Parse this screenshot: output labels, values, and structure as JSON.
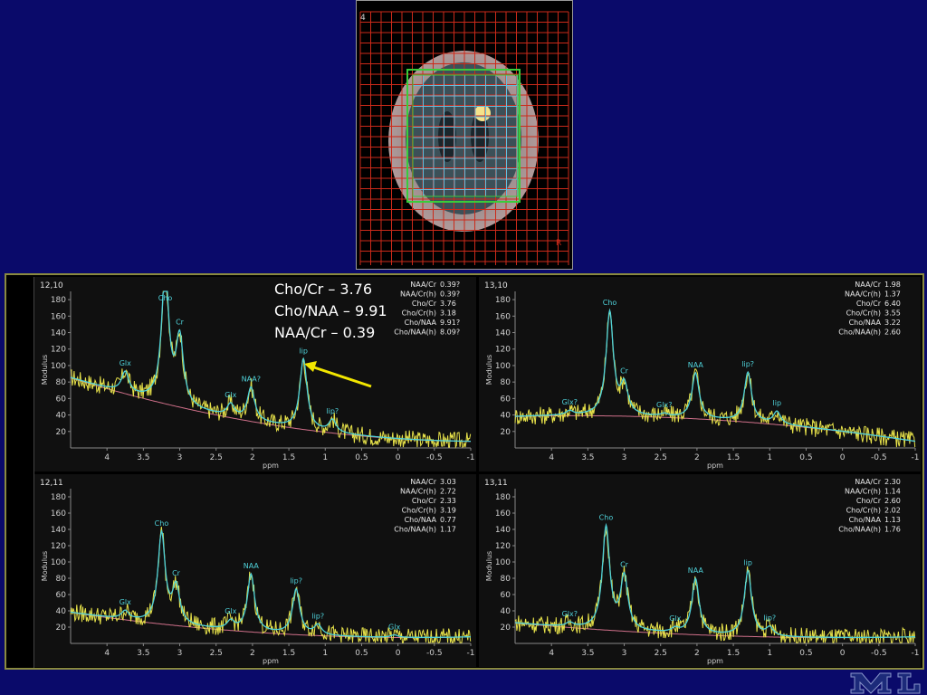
{
  "mri": {
    "slice_label": "4",
    "corner_label": "R"
  },
  "annotation": {
    "lines": [
      "Cho/Cr – 3.76",
      "Cho/NAA – 9.91",
      "NAA/Cr – 0.39"
    ]
  },
  "colors": {
    "background": "#0a0a6a",
    "fit": "#4fd1d9",
    "raw": "#e7e24a",
    "baseline": "#d0708a",
    "annotation_arrow": "#f2e600",
    "grid_red": "#cc2a1a",
    "grid_green": "#3acc3a",
    "grid_cyan": "#60c0e0"
  },
  "chart_data": [
    {
      "type": "line",
      "panel_label": "12,10",
      "xlabel": "ppm",
      "ylabel": "Modulus",
      "xlim": [
        4.5,
        -1
      ],
      "ylim": [
        0,
        190
      ],
      "x_ticks": [
        "4",
        "3.5",
        "3",
        "2.5",
        "2",
        "1.5",
        "1",
        "0.5",
        "0",
        "-0.5",
        "-1"
      ],
      "y_ticks": [
        20,
        40,
        60,
        80,
        100,
        120,
        140,
        160,
        180
      ],
      "peaks": [
        {
          "label": "Cho",
          "ppm": 3.2,
          "height": 160
        },
        {
          "label": "Cr",
          "ppm": 3.0,
          "height": 80
        },
        {
          "label": "Glx",
          "ppm": 3.75,
          "height": 25
        },
        {
          "label": "NAA?",
          "ppm": 2.02,
          "height": 40
        },
        {
          "label": "Glx",
          "ppm": 2.3,
          "height": 15
        },
        {
          "label": "lip",
          "ppm": 1.3,
          "height": 85
        },
        {
          "label": "lip?",
          "ppm": 0.9,
          "height": 15
        }
      ],
      "baseline_start": 85,
      "baseline_mid": 10,
      "baseline_end": 8,
      "stats": [
        {
          "label": "NAA/Cr",
          "value": "0.39?"
        },
        {
          "label": "NAA/Cr(h)",
          "value": "0.39?"
        },
        {
          "label": "Cho/Cr",
          "value": "3.76"
        },
        {
          "label": "Cho/Cr(h)",
          "value": "3.18"
        },
        {
          "label": "Cho/NAA",
          "value": "9.91?"
        },
        {
          "label": "Cho/NAA(h)",
          "value": "8.09?"
        }
      ]
    },
    {
      "type": "line",
      "panel_label": "13,10",
      "xlabel": "ppm",
      "ylabel": "Modulus",
      "xlim": [
        4.5,
        -1
      ],
      "ylim": [
        0,
        190
      ],
      "x_ticks": [
        "4",
        "3.5",
        "3",
        "2.5",
        "2",
        "1.5",
        "1",
        "0.5",
        "0",
        "-0.5",
        "-1"
      ],
      "y_ticks": [
        20,
        40,
        60,
        80,
        100,
        120,
        140,
        160,
        180
      ],
      "peaks": [
        {
          "label": "Cho",
          "ppm": 3.2,
          "height": 125
        },
        {
          "label": "Cr",
          "ppm": 3.0,
          "height": 35
        },
        {
          "label": "Glx?",
          "ppm": 3.75,
          "height": 5
        },
        {
          "label": "Glx?",
          "ppm": 2.45,
          "height": 3
        },
        {
          "label": "NAA",
          "ppm": 2.02,
          "height": 55
        },
        {
          "label": "lip?",
          "ppm": 1.3,
          "height": 60
        },
        {
          "label": "lip",
          "ppm": 0.9,
          "height": 15
        }
      ],
      "baseline_start": 38,
      "baseline_mid": 45,
      "baseline_end": 8,
      "stats": [
        {
          "label": "NAA/Cr",
          "value": "1.98"
        },
        {
          "label": "NAA/Cr(h)",
          "value": "1.37"
        },
        {
          "label": "Cho/Cr",
          "value": "6.40"
        },
        {
          "label": "Cho/Cr(h)",
          "value": "3.55"
        },
        {
          "label": "Cho/NAA",
          "value": "3.22"
        },
        {
          "label": "Cho/NAA(h)",
          "value": "2.60"
        }
      ]
    },
    {
      "type": "line",
      "panel_label": "12,11",
      "xlabel": "ppm",
      "ylabel": "Modulus",
      "xlim": [
        4.5,
        -1
      ],
      "ylim": [
        0,
        190
      ],
      "x_ticks": [
        "4",
        "3.5",
        "3",
        "2.5",
        "2",
        "1.5",
        "1",
        "0.5",
        "0",
        "-0.5",
        "-1"
      ],
      "y_ticks": [
        20,
        40,
        60,
        80,
        100,
        120,
        140,
        160,
        180
      ],
      "peaks": [
        {
          "label": "Cho",
          "ppm": 3.25,
          "height": 110
        },
        {
          "label": "Cr",
          "ppm": 3.05,
          "height": 45
        },
        {
          "label": "Glx",
          "ppm": 3.75,
          "height": 10
        },
        {
          "label": "Glx",
          "ppm": 2.3,
          "height": 10
        },
        {
          "label": "NAA",
          "ppm": 2.02,
          "height": 70
        },
        {
          "label": "lip?",
          "ppm": 1.4,
          "height": 55
        },
        {
          "label": "lip?",
          "ppm": 1.1,
          "height": 12
        },
        {
          "label": "Glx",
          "ppm": 0.05,
          "height": 3
        }
      ],
      "baseline_start": 38,
      "baseline_mid": 2,
      "baseline_end": 8,
      "stats": [
        {
          "label": "NAA/Cr",
          "value": "3.03"
        },
        {
          "label": "NAA/Cr(h)",
          "value": "2.72"
        },
        {
          "label": "Cho/Cr",
          "value": "2.33"
        },
        {
          "label": "Cho/Cr(h)",
          "value": "3.19"
        },
        {
          "label": "Cho/NAA",
          "value": "0.77"
        },
        {
          "label": "Cho/NAA(h)",
          "value": "1.17"
        }
      ]
    },
    {
      "type": "line",
      "panel_label": "13,11",
      "xlabel": "ppm",
      "ylabel": "Modulus",
      "xlim": [
        4.5,
        -1
      ],
      "ylim": [
        0,
        190
      ],
      "x_ticks": [
        "4",
        "3.5",
        "3",
        "2.5",
        "2",
        "1.5",
        "1",
        "0.5",
        "0",
        "-0.5",
        "-1"
      ],
      "y_ticks": [
        20,
        40,
        60,
        80,
        100,
        120,
        140,
        160,
        180
      ],
      "peaks": [
        {
          "label": "Cho",
          "ppm": 3.25,
          "height": 125
        },
        {
          "label": "Cr",
          "ppm": 3.0,
          "height": 65
        },
        {
          "label": "Glx?",
          "ppm": 3.75,
          "height": 5
        },
        {
          "label": "Glx",
          "ppm": 2.3,
          "height": 5
        },
        {
          "label": "NAA",
          "ppm": 2.02,
          "height": 68
        },
        {
          "label": "lip",
          "ppm": 1.3,
          "height": 80
        },
        {
          "label": "lip?",
          "ppm": 1.0,
          "height": 10
        }
      ],
      "baseline_start": 25,
      "baseline_mid": 3,
      "baseline_end": 8,
      "stats": [
        {
          "label": "NAA/Cr",
          "value": "2.30"
        },
        {
          "label": "NAA/Cr(h)",
          "value": "1.14"
        },
        {
          "label": "Cho/Cr",
          "value": "2.60"
        },
        {
          "label": "Cho/Cr(h)",
          "value": "2.02"
        },
        {
          "label": "Cho/NAA",
          "value": "1.13"
        },
        {
          "label": "Cho/NAA(h)",
          "value": "1.76"
        }
      ]
    }
  ]
}
